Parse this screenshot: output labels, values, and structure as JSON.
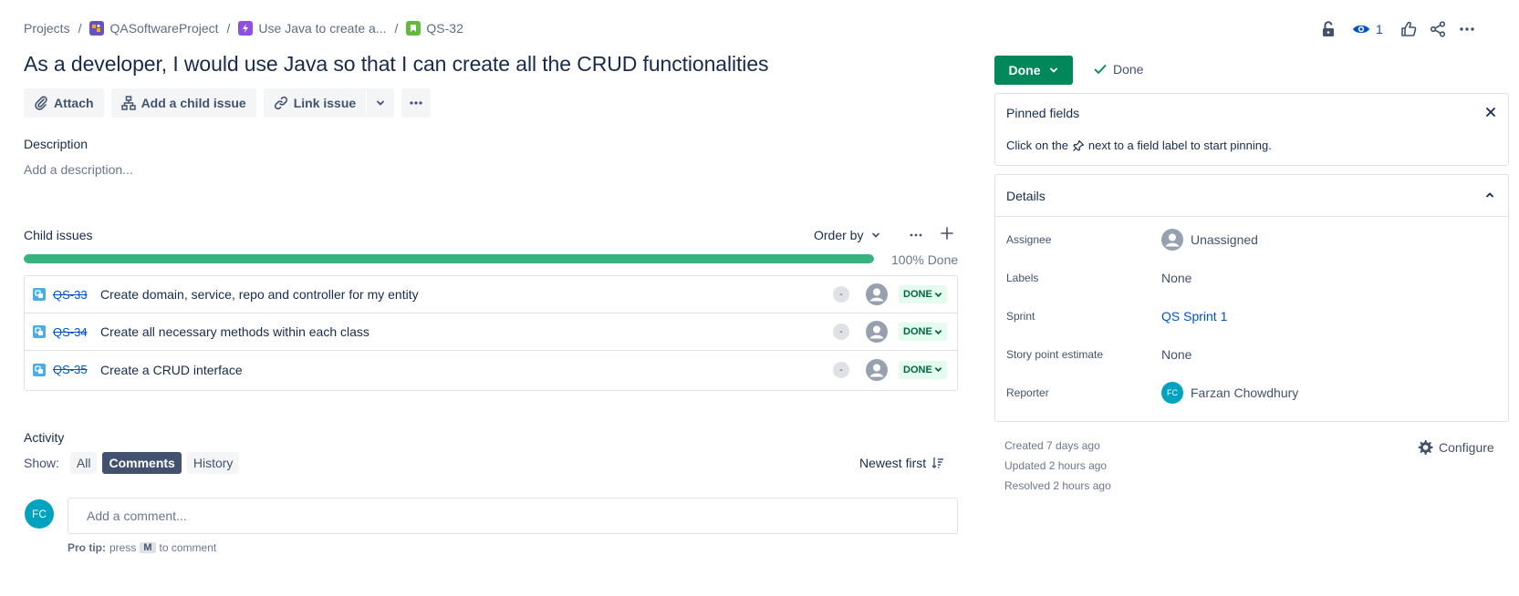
{
  "breadcrumb": {
    "projects": "Projects",
    "project": "QASoftwareProject",
    "epic": "Use Java to create a...",
    "issue_key": "QS-32",
    "sep": "/"
  },
  "issue": {
    "title": "As a developer, I would use Java so that I can create all the CRUD functionalities"
  },
  "toolbar": {
    "attach": "Attach",
    "add_child": "Add a child issue",
    "link_issue": "Link issue"
  },
  "description": {
    "label": "Description",
    "placeholder": "Add a description..."
  },
  "child_issues": {
    "label": "Child issues",
    "order_by": "Order by",
    "progress_percent": 100,
    "progress_text": "100% Done",
    "items": [
      {
        "key": "QS-33",
        "summary": "Create domain, service, repo and controller for my entity",
        "priority": "-",
        "status": "DONE"
      },
      {
        "key": "QS-34",
        "summary": "Create all necessary methods within each class",
        "priority": "-",
        "status": "DONE"
      },
      {
        "key": "QS-35",
        "summary": "Create a CRUD interface",
        "priority": "-",
        "status": "DONE"
      }
    ]
  },
  "activity": {
    "label": "Activity",
    "show_label": "Show:",
    "filters": [
      "All",
      "Comments",
      "History"
    ],
    "active_filter": "Comments",
    "sort": "Newest first",
    "comment_placeholder": "Add a comment...",
    "avatar_initials": "FC",
    "protip_bold": "Pro tip:",
    "protip_press": "press",
    "protip_key": "M",
    "protip_rest": "to comment"
  },
  "header_actions": {
    "watch_count": "1",
    "icons": [
      "lock-icon",
      "watch-icon",
      "like-icon",
      "share-icon",
      "more-icon"
    ]
  },
  "status": {
    "button": "Done",
    "resolution": "Done"
  },
  "pinned": {
    "title": "Pinned fields",
    "text_before": "Click on the",
    "text_after": "next to a field label to start pinning."
  },
  "details": {
    "title": "Details",
    "assignee_label": "Assignee",
    "assignee": "Unassigned",
    "labels_label": "Labels",
    "labels": "None",
    "sprint_label": "Sprint",
    "sprint": "QS Sprint 1",
    "story_points_label": "Story point estimate",
    "story_points": "None",
    "reporter_label": "Reporter",
    "reporter": "Farzan Chowdhury",
    "reporter_initials": "FC"
  },
  "meta": {
    "created": "Created 7 days ago",
    "updated": "Updated 2 hours ago",
    "resolved": "Resolved 2 hours ago",
    "configure": "Configure"
  },
  "colors": {
    "done_green": "#00875a",
    "progress_green": "#36b37e",
    "link_blue": "#0052cc",
    "avatar_teal": "#00a3bf"
  }
}
